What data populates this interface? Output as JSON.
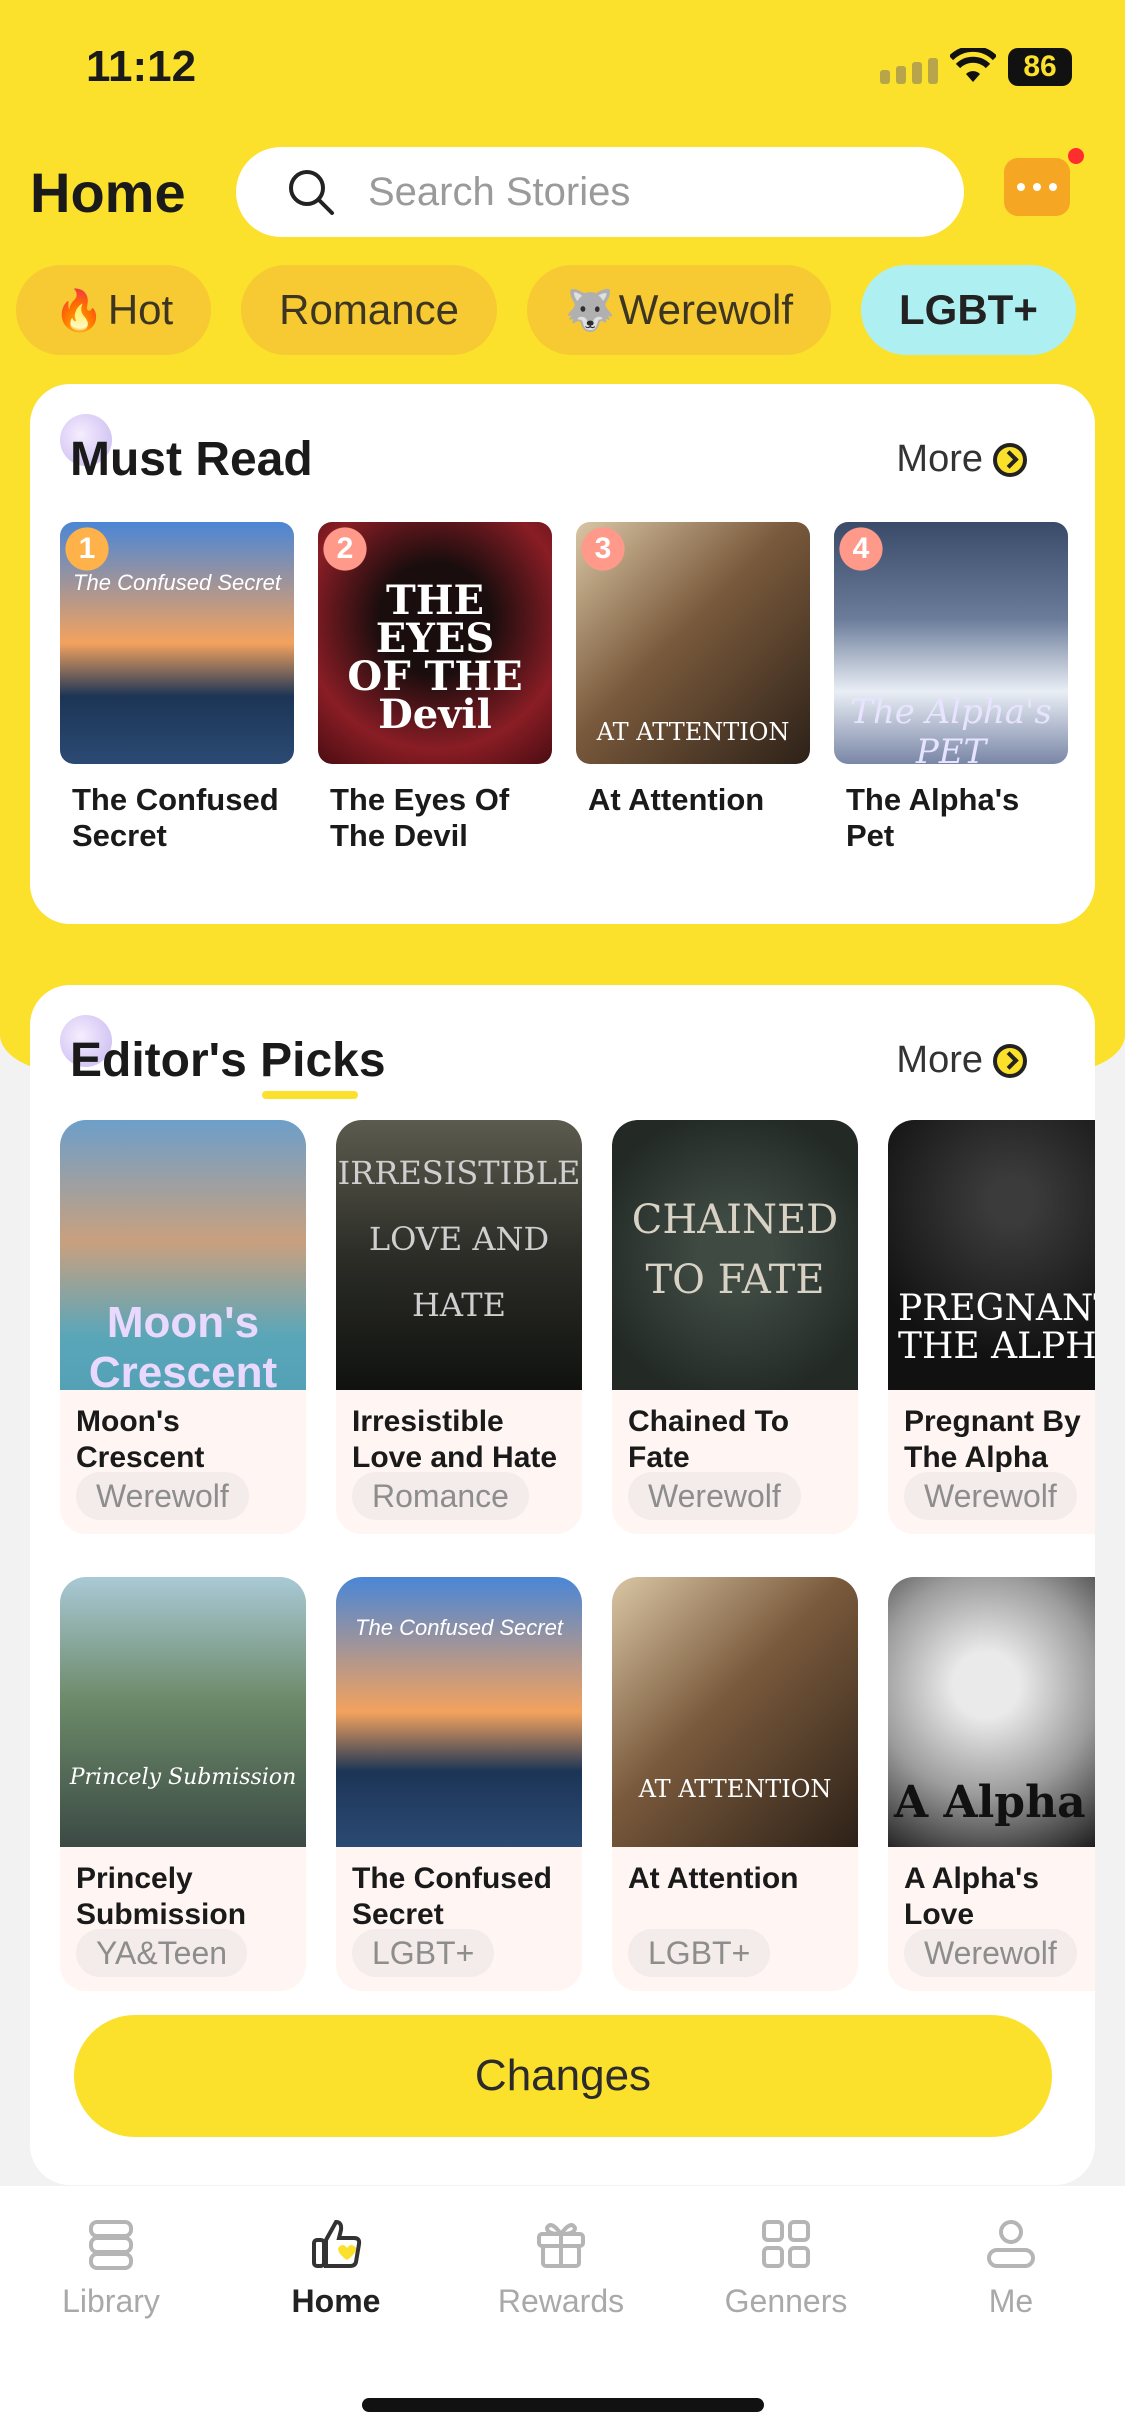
{
  "status": {
    "time": "11:12",
    "battery": "86"
  },
  "header": {
    "title": "Home",
    "search_placeholder": "Search Stories"
  },
  "tabs": [
    {
      "label": "Hot",
      "icon": "🔥"
    },
    {
      "label": "Romance",
      "icon": ""
    },
    {
      "label": "Werewolf",
      "icon": "🐺"
    },
    {
      "label": "LGBT+",
      "icon": ""
    }
  ],
  "must_read": {
    "title": "Must Read",
    "more": "More",
    "books": [
      {
        "rank": "1",
        "title": "The Confused Secret",
        "cover_text": "The Confused Secret"
      },
      {
        "rank": "2",
        "title": "The Eyes Of The Devil",
        "cover_text": "THE EYES OF THE Devil"
      },
      {
        "rank": "3",
        "title": "At Attention",
        "cover_text": "AT ATTENTION"
      },
      {
        "rank": "4",
        "title": "The Alpha's Pet",
        "cover_text": "The Alpha's PET"
      }
    ]
  },
  "editors_picks": {
    "title": "Editor's Picks",
    "more": "More",
    "items": [
      {
        "title": "Moon's Crescent",
        "tag": "Werewolf",
        "cover_text": "Moon's Crescent"
      },
      {
        "title": "Irresistible Love and Hate",
        "tag": "Romance",
        "cover_text": "IRRESISTIBLE LOVE AND HATE"
      },
      {
        "title": "Chained To Fate",
        "tag": "Werewolf",
        "cover_text": "CHAINED TO FATE"
      },
      {
        "title": "Pregnant By The Alpha",
        "tag": "Werewolf",
        "cover_text": "PREGNANT BY THE ALPHA"
      },
      {
        "title": "Princely Submission",
        "tag": "YA&Teen",
        "cover_text": "Princely Submission"
      },
      {
        "title": "The Confused Secret",
        "tag": "LGBT+",
        "cover_text": "The Confused Secret"
      },
      {
        "title": "At Attention",
        "tag": "LGBT+",
        "cover_text": "AT ATTENTION"
      },
      {
        "title": "A Alpha's Love",
        "tag": "Werewolf",
        "cover_text": "A Alpha"
      }
    ]
  },
  "changes_label": "Changes",
  "nav": [
    {
      "label": "Library",
      "icon": "library-icon"
    },
    {
      "label": "Home",
      "icon": "home-thumb-icon"
    },
    {
      "label": "Rewards",
      "icon": "gift-icon"
    },
    {
      "label": "Genners",
      "icon": "grid-icon"
    },
    {
      "label": "Me",
      "icon": "user-icon"
    }
  ],
  "colors": {
    "brand_yellow": "#fbe02c",
    "tab_bg": "#f7c933",
    "tab_active": "#aef0f2",
    "msg_orange": "#f5a623"
  }
}
